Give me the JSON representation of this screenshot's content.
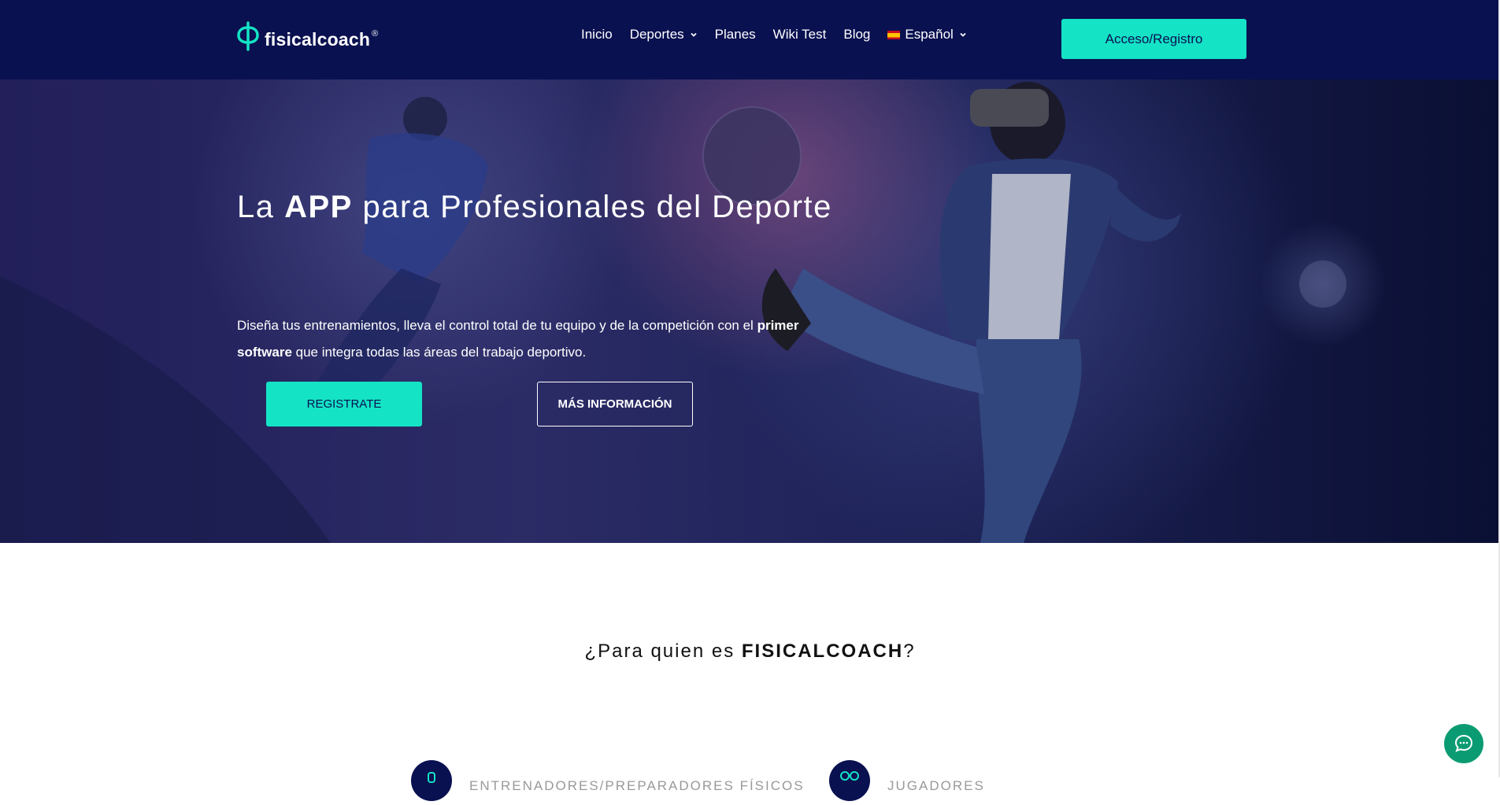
{
  "header": {
    "logo_text": "fisicalcoach",
    "logo_reg": "®",
    "nav": [
      {
        "label": "Inicio"
      },
      {
        "label": "Deportes"
      },
      {
        "label": "Planes"
      },
      {
        "label": "Wiki Test"
      },
      {
        "label": "Blog"
      },
      {
        "label": "Español"
      }
    ],
    "cta_label": "Acceso/Registro"
  },
  "hero": {
    "title_pre": "La ",
    "title_bold": "APP",
    "title_post": " para Profesionales del Deporte",
    "desc_pre": "Diseña tus entrenamientos, lleva el control total de tu equipo y de la competición con el ",
    "desc_bold": "primer software",
    "desc_post": " que integra todas las áreas del trabajo deportivo.",
    "btn_primary": "REGISTRATE",
    "btn_secondary": "MÁS INFORMACIÓN"
  },
  "section": {
    "title_pre": "¿Para quien es ",
    "title_bold": "FISICALCOACH",
    "title_post": "?",
    "features": [
      {
        "label": "ENTRENADORES/PREPARADORES FÍSICOS",
        "icon": "whistle-icon"
      },
      {
        "label": "JUGADORES",
        "icon": "players-icon"
      }
    ]
  },
  "colors": {
    "navy": "#0a1150",
    "accent": "#14e3c5",
    "chat": "#0b9b72"
  }
}
